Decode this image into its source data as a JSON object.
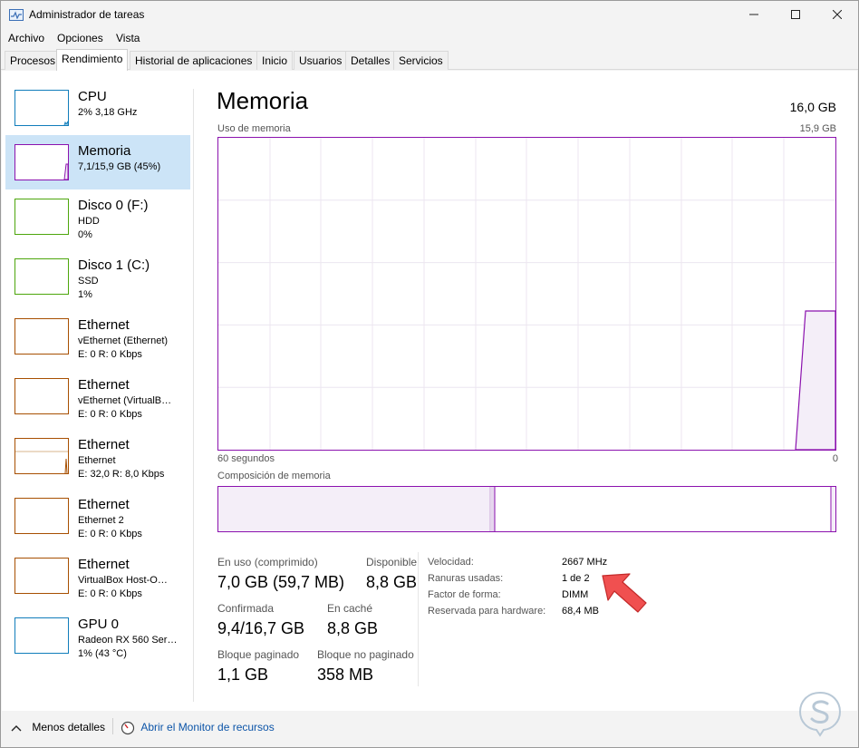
{
  "window": {
    "title": "Administrador de tareas"
  },
  "menu": {
    "items": [
      "Archivo",
      "Opciones",
      "Vista"
    ]
  },
  "tabs": [
    "Procesos",
    "Rendimiento",
    "Historial de aplicaciones",
    "Inicio",
    "Usuarios",
    "Detalles",
    "Servicios"
  ],
  "active_tab": "Rendimiento",
  "sidebar": {
    "items": [
      {
        "title": "CPU",
        "line1": "2% 3,18 GHz",
        "line2": "",
        "color": "#117dbb"
      },
      {
        "title": "Memoria",
        "line1": "7,1/15,9 GB (45%)",
        "line2": "",
        "color": "#8b12ae"
      },
      {
        "title": "Disco 0 (F:)",
        "line1": "HDD",
        "line2": "0%",
        "color": "#4da60c"
      },
      {
        "title": "Disco 1 (C:)",
        "line1": "SSD",
        "line2": "1%",
        "color": "#4da60c"
      },
      {
        "title": "Ethernet",
        "line1": "vEthernet (Ethernet)",
        "line2": "E: 0 R: 0 Kbps",
        "color": "#a74f01"
      },
      {
        "title": "Ethernet",
        "line1": "vEthernet (VirtualB…",
        "line2": "E: 0 R: 0 Kbps",
        "color": "#a74f01"
      },
      {
        "title": "Ethernet",
        "line1": "Ethernet",
        "line2": "E: 32,0 R: 8,0 Kbps",
        "color": "#a74f01"
      },
      {
        "title": "Ethernet",
        "line1": "Ethernet 2",
        "line2": "E: 0 R: 0 Kbps",
        "color": "#a74f01"
      },
      {
        "title": "Ethernet",
        "line1": "VirtualBox Host-O…",
        "line2": "E: 0 R: 0 Kbps",
        "color": "#a74f01"
      },
      {
        "title": "GPU 0",
        "line1": "Radeon RX 560 Ser…",
        "line2": "1% (43 °C)",
        "color": "#117dbb"
      }
    ]
  },
  "main": {
    "title": "Memoria",
    "total": "16,0 GB",
    "usage_label": "Uso de memoria",
    "usage_max": "15,9 GB",
    "time_left": "60 segundos",
    "time_right": "0",
    "composition_label": "Composición de memoria",
    "stats": {
      "in_use_label": "En uso (comprimido)",
      "in_use_value": "7,0 GB (59,7 MB)",
      "available_label": "Disponible",
      "available_value": "8,8 GB",
      "committed_label": "Confirmada",
      "committed_value": "9,4/16,7 GB",
      "cached_label": "En caché",
      "cached_value": "8,8 GB",
      "paged_label": "Bloque paginado",
      "paged_value": "1,1 GB",
      "nonpaged_label": "Bloque no paginado",
      "nonpaged_value": "358 MB"
    },
    "specs": {
      "speed_label": "Velocidad:",
      "speed_value": "2667 MHz",
      "slots_label": "Ranuras usadas:",
      "slots_value": "1 de 2",
      "form_label": "Factor de forma:",
      "form_value": "DIMM",
      "reserved_label": "Reservada para hardware:",
      "reserved_value": "68,4 MB"
    }
  },
  "footer": {
    "less_details": "Menos detalles",
    "resource_monitor": "Abrir el Monitor de recursos"
  },
  "colors": {
    "memory": "#8b12ae",
    "selected": "#cce4f7",
    "link": "#0d55a8",
    "arrow": "#f04a4a"
  }
}
